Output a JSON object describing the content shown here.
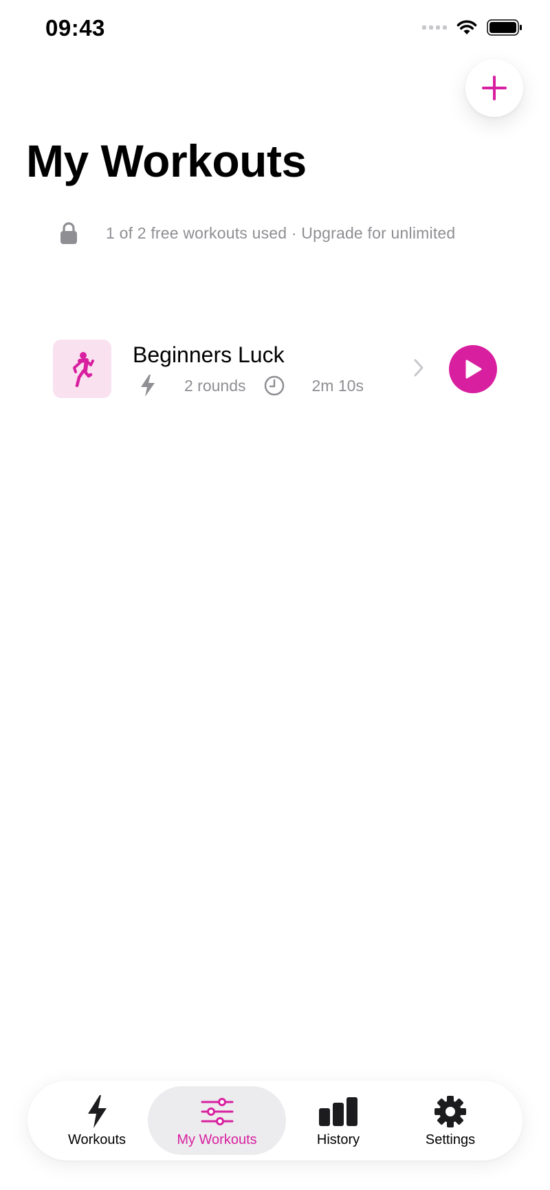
{
  "status_bar": {
    "time": "09:43"
  },
  "header": {
    "title": "My Workouts",
    "add_icon": "plus-icon"
  },
  "limit_notice": {
    "text": "1 of 2 free workouts used · Upgrade for unlimited",
    "icon": "lock-icon"
  },
  "workouts": [
    {
      "name": "Beginners Luck",
      "rounds": "2 rounds",
      "duration": "2m 10s",
      "icon": "running-figure-icon"
    }
  ],
  "tabs": [
    {
      "label": "Workouts",
      "icon": "bolt-icon",
      "active": false
    },
    {
      "label": "My Workouts",
      "icon": "sliders-icon",
      "active": true
    },
    {
      "label": "History",
      "icon": "bar-chart-icon",
      "active": false
    },
    {
      "label": "Settings",
      "icon": "gear-icon",
      "active": false
    }
  ],
  "colors": {
    "accent": "#d81f9f",
    "accent_light": "#f9e1ef",
    "muted": "#8e8e93"
  }
}
